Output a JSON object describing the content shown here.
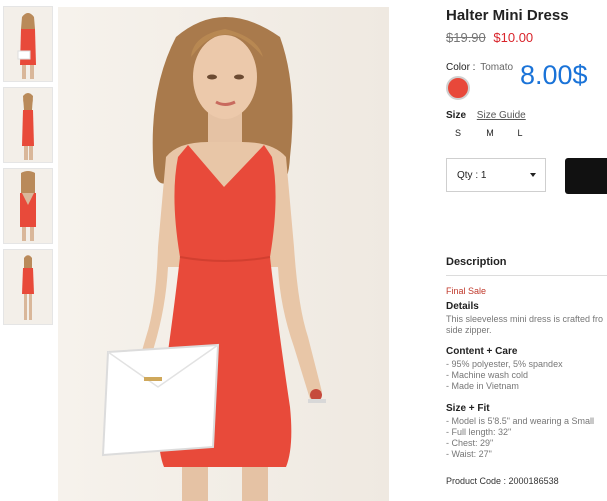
{
  "product": {
    "title": "Halter Mini Dress",
    "old_price": "$19.90",
    "new_price": "$10.00",
    "promo_price": "8.00$",
    "color_label": "Color",
    "color_value": "Tomato",
    "swatch_color": "#e8483a",
    "size_label": "Size",
    "size_guide_label": "Size Guide",
    "sizes": [
      "S",
      "M",
      "L"
    ],
    "qty_label": "Qty : 1",
    "description_heading": "Description",
    "final_sale": "Final Sale",
    "details_title": "Details",
    "details_lines": [
      "This sleeveless mini dress is crafted fro",
      "side zipper."
    ],
    "content_title": "Content + Care",
    "content_lines": [
      "- 95% polyester, 5% spandex",
      "- Machine wash cold",
      "- Made in Vietnam"
    ],
    "fit_title": "Size + Fit",
    "fit_lines": [
      "- Model is 5'8.5\" and wearing a Small",
      "- Full length: 32\"",
      "- Chest: 29\"",
      "- Waist: 27\""
    ],
    "product_code": "Product Code : 2000186538"
  },
  "colors": {
    "dress": "#e84a3a",
    "price_red": "#d9242b",
    "promo_blue": "#1a73d8",
    "button_dark": "#111111"
  }
}
